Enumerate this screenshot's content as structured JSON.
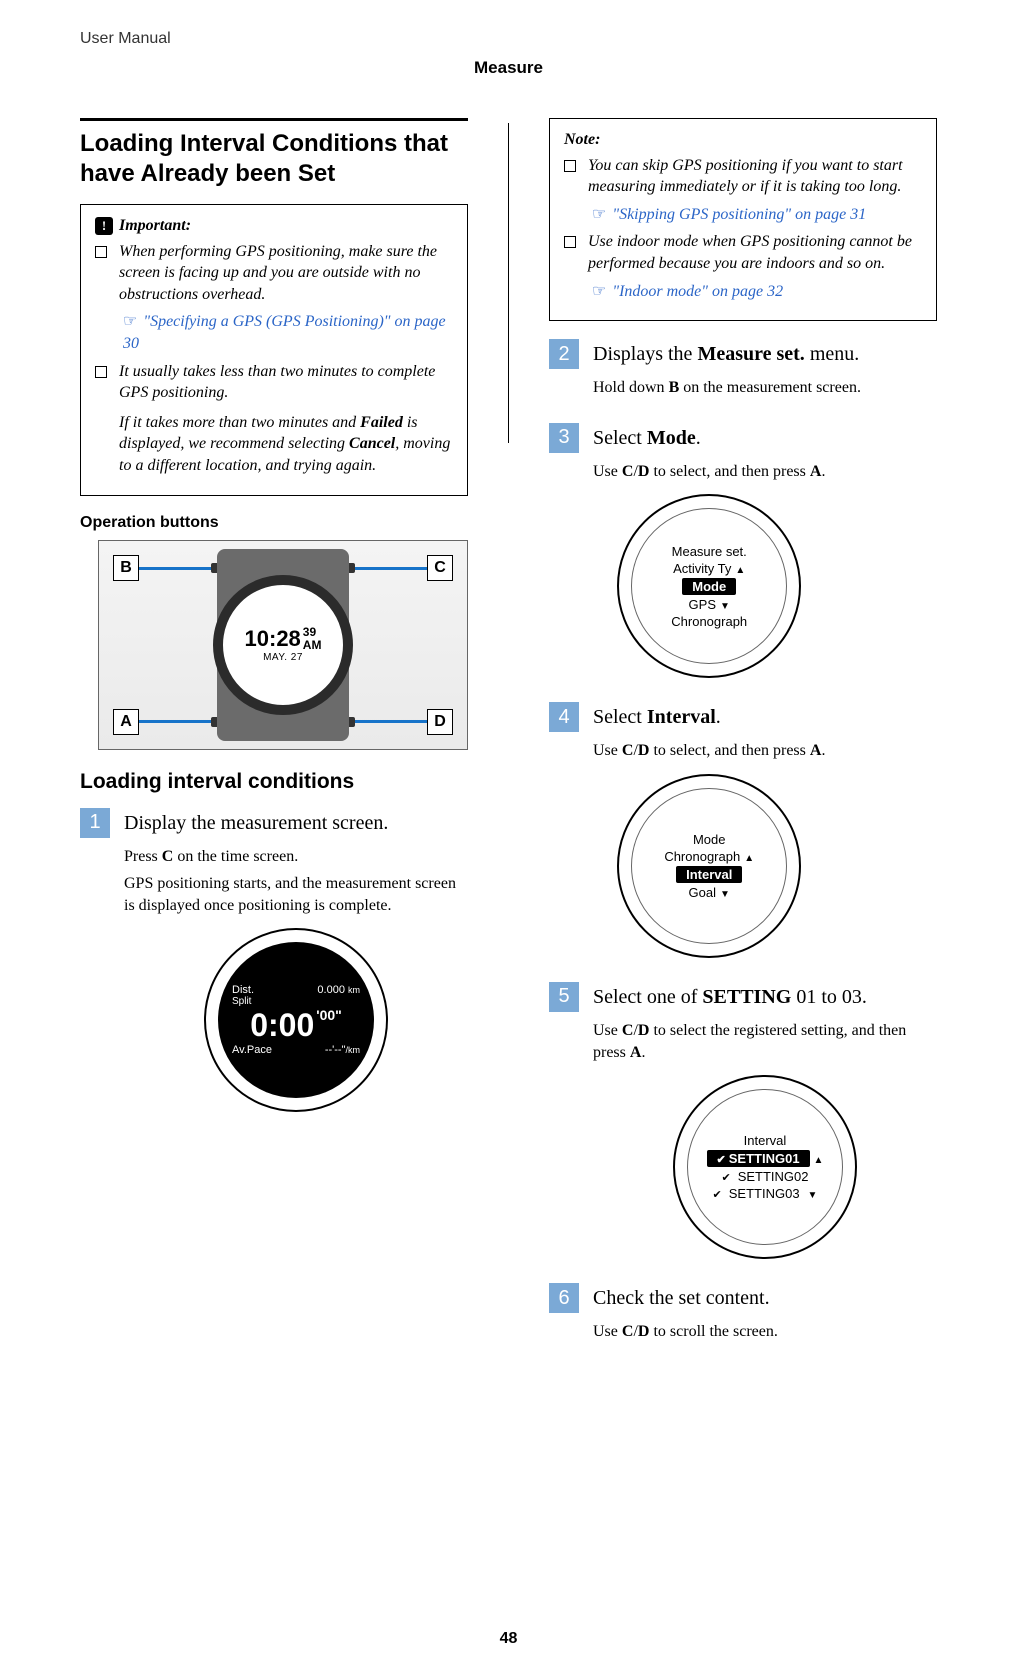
{
  "doc_header": "User Manual",
  "section": "Measure",
  "page_number": "48",
  "main_heading": "Loading Interval Conditions that have Already been Set",
  "important_box": {
    "label": "Important:",
    "items": [
      "When performing GPS positioning, make sure the screen is facing up and you are outside with no obstructions overhead.",
      "It usually takes less than two minutes to complete GPS positioning."
    ],
    "link1": "\"Specifying a GPS (GPS Positioning)\" on page 30",
    "followup": "If it takes more than two minutes and Failed is displayed, we recommend selecting Cancel, moving to a different location, and trying again.",
    "failed_word": "Failed",
    "cancel_word": "Cancel"
  },
  "op_buttons_heading": "Operation buttons",
  "watch": {
    "labels": {
      "A": "A",
      "B": "B",
      "C": "C",
      "D": "D"
    },
    "time": "10:28",
    "sec": "39",
    "ampm": "AM",
    "date": "MAY. 27"
  },
  "subheading": "Loading interval conditions",
  "step1": {
    "title": "Display the measurement screen.",
    "p1_a": "Press ",
    "p1_b": " on the time screen.",
    "btn_c": "C",
    "p2": "GPS positioning starts, and the measurement screen is displayed once positioning is complete.",
    "fig": {
      "dist_lbl": "Dist.",
      "dist_val": "0.000",
      "dist_unit": "km",
      "split_lbl": "Split",
      "big": "0:00",
      "ms": "'00\"",
      "pace_lbl": "Av.Pace",
      "pace_val": "--'--\"",
      "pace_unit": "/km"
    }
  },
  "note_box": {
    "label": "Note:",
    "items": [
      "You can skip GPS positioning if you want to start measuring immediately or if it is taking too long.",
      "Use indoor mode when GPS positioning cannot be performed because you are indoors and so on."
    ],
    "link1": "\"Skipping GPS positioning\" on page 31",
    "link2": "\"Indoor mode\" on page 32"
  },
  "step2": {
    "title_a": "Displays the ",
    "title_b": "Measure set.",
    "title_c": " menu.",
    "p_a": "Hold down ",
    "p_b": " on the measurement screen.",
    "btn_b": "B"
  },
  "step3": {
    "title_a": "Select ",
    "title_b": "Mode",
    "title_c": ".",
    "p_a": "Use ",
    "p_b": " to select, and then press ",
    "p_c": ".",
    "btn_cd": "C",
    "btn_d": "D",
    "btn_a": "A",
    "fig": {
      "top": "Measure set.",
      "row1": "Activity Ty",
      "sel": "Mode",
      "row2": "GPS",
      "bottom": "Chronograph"
    }
  },
  "step4": {
    "title_a": "Select ",
    "title_b": "Interval",
    "title_c": ".",
    "p_same": true,
    "fig": {
      "top": "Mode",
      "row1": "Chronograph",
      "sel": "Interval",
      "row2": "Goal"
    }
  },
  "step5": {
    "title_a": "Select one of ",
    "title_b": "SETTING",
    "title_c": " 01 to 03.",
    "p_a": "Use ",
    "btn_cd": "C",
    "btn_d": "D",
    "p_b": " to select the registered setting, and then press ",
    "btn_a": "A",
    "p_c": ".",
    "fig": {
      "top": "Interval",
      "r1": "SETTING01",
      "r2": "SETTING02",
      "r3": "SETTING03"
    }
  },
  "step6": {
    "title": "Check the set content.",
    "p_a": "Use ",
    "btn_cd": "C",
    "btn_d": "D",
    "p_b": " to scroll the screen."
  }
}
